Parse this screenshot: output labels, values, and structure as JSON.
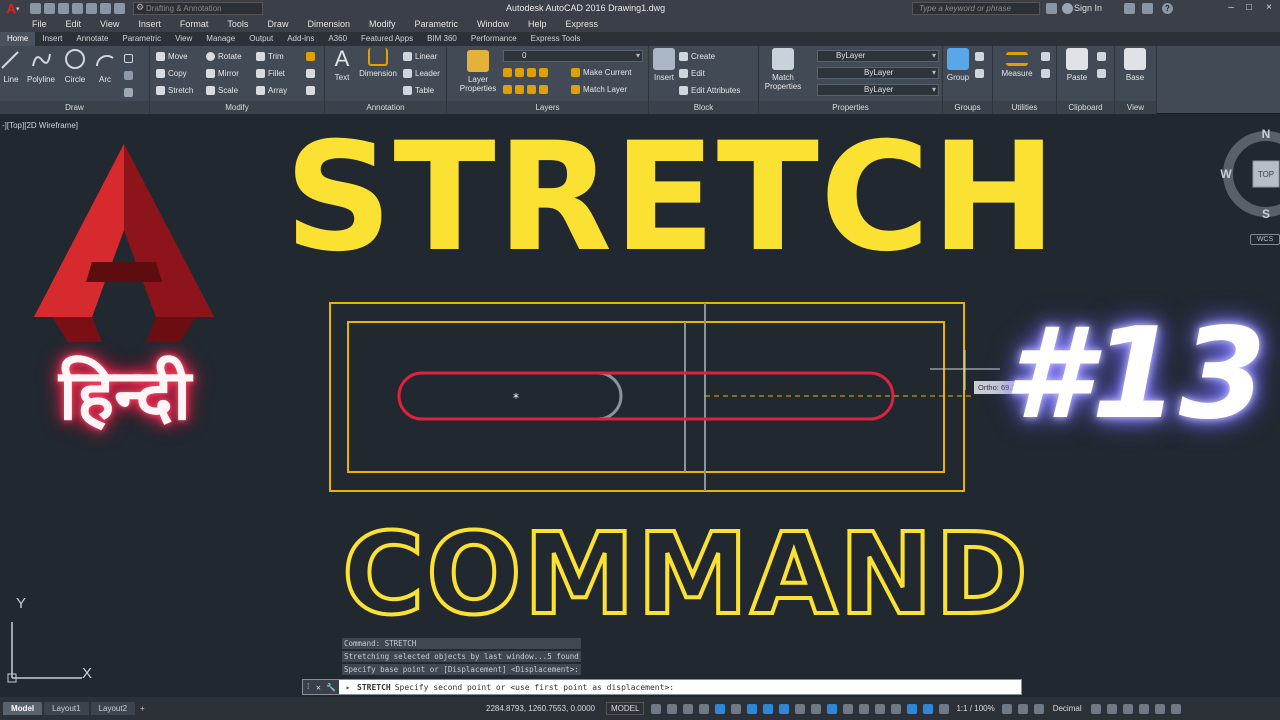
{
  "titlebar": {
    "workspace": "Drafting & Annotation",
    "title": "Autodesk AutoCAD 2016    Drawing1.dwg",
    "search_placeholder": "Type a keyword or phrase",
    "signin": "Sign In",
    "help": "?"
  },
  "menu": [
    "File",
    "Edit",
    "View",
    "Insert",
    "Format",
    "Tools",
    "Draw",
    "Dimension",
    "Modify",
    "Parametric",
    "Window",
    "Help",
    "Express"
  ],
  "tabs": [
    "Home",
    "Insert",
    "Annotate",
    "Parametric",
    "View",
    "Manage",
    "Output",
    "Add-ins",
    "A360",
    "Featured Apps",
    "BIM 360",
    "Performance",
    "Express Tools"
  ],
  "ribbon": {
    "draw": {
      "title": "Draw",
      "line": "Line",
      "polyline": "Polyline",
      "circle": "Circle",
      "arc": "Arc"
    },
    "modify": {
      "title": "Modify",
      "move": "Move",
      "rotate": "Rotate",
      "trim": "Trim",
      "copy": "Copy",
      "mirror": "Mirror",
      "fillet": "Fillet",
      "stretch": "Stretch",
      "scale": "Scale",
      "array": "Array"
    },
    "annotation": {
      "title": "Annotation",
      "text": "Text",
      "dimension": "Dimension",
      "linear": "Linear",
      "leader": "Leader",
      "table": "Table"
    },
    "layers": {
      "title": "Layers",
      "properties": "Layer Properties",
      "current_layer": "0",
      "make_current": "Make Current",
      "match_layer": "Match Layer"
    },
    "block": {
      "title": "Block",
      "insert": "Insert",
      "create": "Create",
      "edit": "Edit",
      "edit_attributes": "Edit Attributes"
    },
    "properties": {
      "title": "Properties",
      "match": "Match Properties",
      "color": "ByLayer",
      "linetype": "ByLayer",
      "lineweight": "ByLayer"
    },
    "groups": {
      "title": "Groups",
      "group": "Group"
    },
    "utilities": {
      "title": "Utilities",
      "measure": "Measure"
    },
    "clipboard": {
      "title": "Clipboard",
      "paste": "Paste"
    },
    "view": {
      "title": "View",
      "base": "Base"
    }
  },
  "viewport_label": "-][Top][2D Wireframe]",
  "viewcube": {
    "n": "N",
    "s": "S",
    "w": "W",
    "face": "TOP",
    "wcs": "WCS"
  },
  "overlay": {
    "headline": "STRETCH",
    "subheadline": "COMMAND",
    "language": "हिन्दी",
    "episode": "#13"
  },
  "ortho_tooltip": {
    "label": "Ortho:",
    "value": "69.3369"
  },
  "ucs": {
    "x": "X",
    "y": "Y"
  },
  "command": {
    "history": [
      "Command: STRETCH",
      "Stretching selected objects by last window...5 found",
      "Specify base point or [Displacement] <Displacement>:"
    ],
    "current_keyword": "STRETCH",
    "current_prompt": "Specify second point or <use first point as displacement>:"
  },
  "layout_tabs": [
    "Model",
    "Layout1",
    "Layout2"
  ],
  "status": {
    "coords": "2284.8793, 1260.7553, 0.0000",
    "space": "MODEL",
    "scale": "1:1 / 100%",
    "units": "Decimal"
  },
  "colors": {
    "background": "#212830",
    "title_yellow": "#fbe132",
    "slot_red": "#e0213e",
    "rect_orange": "#e8b400"
  }
}
